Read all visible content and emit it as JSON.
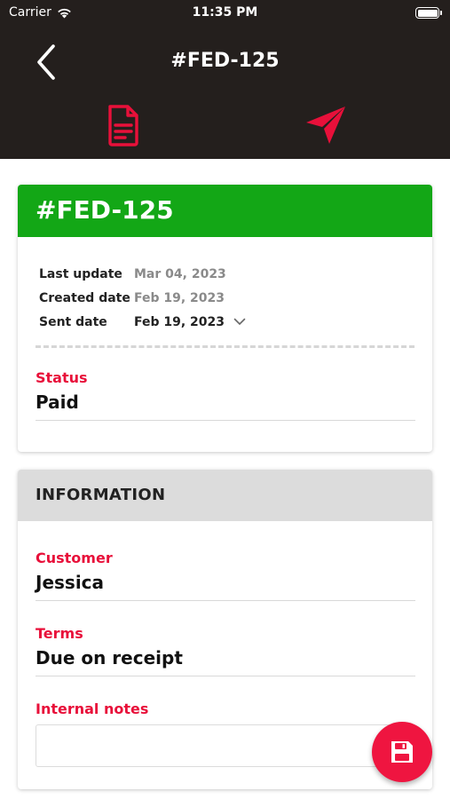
{
  "status_bar": {
    "carrier": "Carrier",
    "time": "11:35 PM",
    "battery_level": 1.0
  },
  "nav": {
    "title": "#FED-125",
    "back_icon": "chevron-left-icon",
    "tabs": [
      {
        "name": "document",
        "icon": "document-icon"
      },
      {
        "name": "send",
        "icon": "send-icon"
      }
    ]
  },
  "invoice": {
    "number": "#FED-125",
    "dates": [
      {
        "label": "Last update",
        "value": "Mar 04, 2023"
      },
      {
        "label": "Created date",
        "value": "Feb 19, 2023"
      },
      {
        "label": "Sent date",
        "value": "Feb 19, 2023"
      }
    ],
    "status": {
      "label": "Status",
      "value": "Paid"
    }
  },
  "information": {
    "title": "INFORMATION",
    "customer": {
      "label": "Customer",
      "value": "Jessica"
    },
    "terms": {
      "label": "Terms",
      "value": "Due on receipt"
    },
    "notes": {
      "label": "Internal notes",
      "value": ""
    }
  },
  "colors": {
    "header": "#241f1d",
    "accent": "#e8103a",
    "status_green": "#13a716",
    "fab": "#ef1540"
  }
}
